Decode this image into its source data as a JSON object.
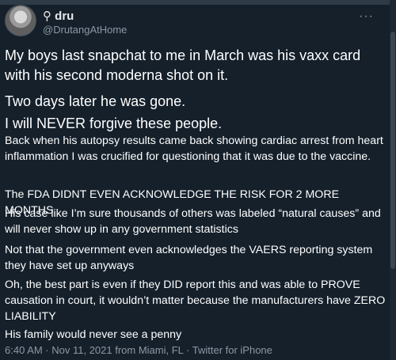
{
  "author": {
    "display_name": "⚲ dru",
    "handle": "@DrutangAtHome"
  },
  "more_icon": "more-icon",
  "tweet": {
    "paragraphs_large": [
      "My boys last snapchat to me in March was his vaxx card with his second moderna shot on it.",
      "Two days later he was gone.",
      "I will NEVER forgive these people."
    ],
    "paragraphs_small": [
      "Back when his autopsy results came back showing cardiac arrest from heart inflammation I was crucified for questioning that it was due to the vaccine.",
      "The FDA DIDNT EVEN ACKNOWLEDGE THE RISK FOR 2 MORE MONTHS",
      "His case like I’m sure thousands of others was labeled “natural causes” and will never show up in any government statistics",
      "Not that the government even acknowledges the VAERS reporting system they have set up anyways",
      "Oh, the best part is even if they DID report this and was able to PROVE causation in court, it wouldn’t matter because the manufacturers have ZERO LIABILITY",
      "His family would never see a penny"
    ]
  },
  "meta_line": "6:40 AM · Nov 11, 2021 from Miami, FL · Twitter for iPhone"
}
